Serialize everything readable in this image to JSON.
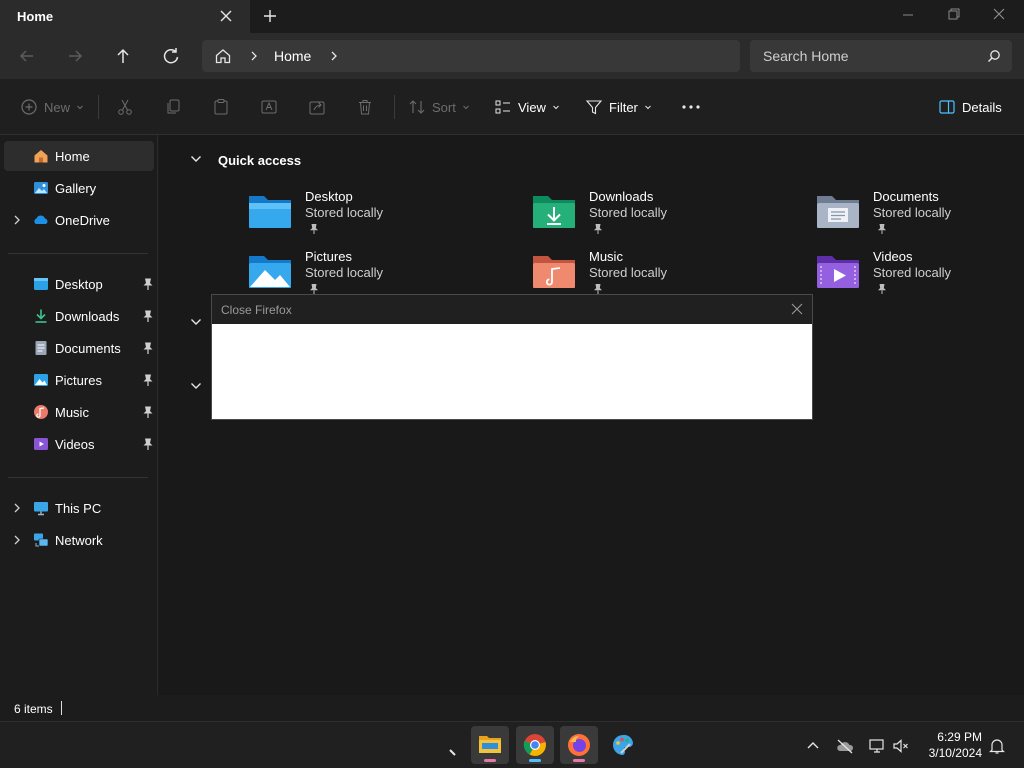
{
  "titlebar": {
    "tab_title": "Home"
  },
  "address": {
    "breadcrumb_item": "Home",
    "search_placeholder": "Search Home"
  },
  "toolbar": {
    "new_label": "New",
    "sort_label": "Sort",
    "view_label": "View",
    "filter_label": "Filter",
    "details_label": "Details"
  },
  "sidebar": {
    "top": [
      {
        "label": "Home",
        "icon": "home-icon",
        "selected": true
      },
      {
        "label": "Gallery",
        "icon": "gallery-icon"
      },
      {
        "label": "OneDrive",
        "icon": "onedrive-icon",
        "expandable": true
      }
    ],
    "pinned": [
      {
        "label": "Desktop",
        "icon": "desktop-folder-icon"
      },
      {
        "label": "Downloads",
        "icon": "downloads-folder-icon"
      },
      {
        "label": "Documents",
        "icon": "documents-folder-icon"
      },
      {
        "label": "Pictures",
        "icon": "pictures-folder-icon"
      },
      {
        "label": "Music",
        "icon": "music-folder-icon"
      },
      {
        "label": "Videos",
        "icon": "videos-folder-icon"
      }
    ],
    "bottom": [
      {
        "label": "This PC",
        "icon": "this-pc-icon"
      },
      {
        "label": "Network",
        "icon": "network-icon"
      }
    ]
  },
  "main": {
    "quick_access_title": "Quick access",
    "tiles": [
      {
        "name": "Desktop",
        "sub": "Stored locally"
      },
      {
        "name": "Downloads",
        "sub": "Stored locally"
      },
      {
        "name": "Documents",
        "sub": "Stored locally"
      },
      {
        "name": "Pictures",
        "sub": "Stored locally"
      },
      {
        "name": "Music",
        "sub": "Stored locally"
      },
      {
        "name": "Videos",
        "sub": "Stored locally"
      }
    ]
  },
  "dialog": {
    "title": "Close Firefox"
  },
  "status": {
    "items_text": "6 items"
  },
  "taskbar": {
    "time": "6:29 PM",
    "date": "3/10/2024"
  },
  "colors": {
    "accent": "#4cc2ff",
    "folder_yellow": "#f5c33b",
    "firefox_indicator": "#e879a6"
  }
}
